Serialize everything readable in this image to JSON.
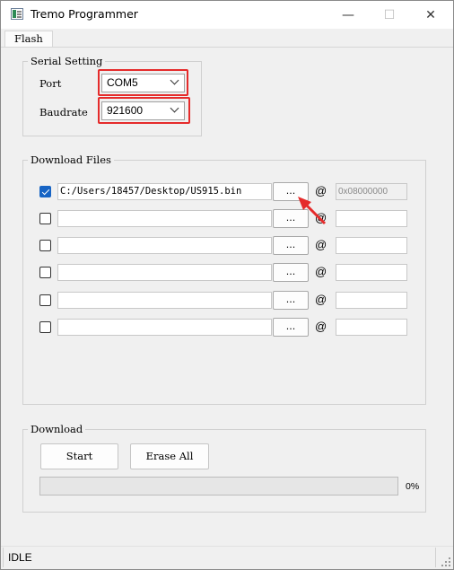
{
  "window": {
    "title": "Tremo Programmer",
    "controls": {
      "minimize": "—",
      "maximize": "☐",
      "close": "✕"
    }
  },
  "menu": {
    "flash": "Flash"
  },
  "serial": {
    "group_title": "Serial Setting",
    "port_label": "Port",
    "port_value": "COM5",
    "baudrate_label": "Baudrate",
    "baudrate_value": "921600"
  },
  "download_files": {
    "group_title": "Download Files",
    "at_symbol": "@",
    "browse_label": "...",
    "rows": [
      {
        "checked": true,
        "path": "C:/Users/18457/Desktop/US915.bin",
        "address": "0x08000000"
      },
      {
        "checked": false,
        "path": "",
        "address": ""
      },
      {
        "checked": false,
        "path": "",
        "address": ""
      },
      {
        "checked": false,
        "path": "",
        "address": ""
      },
      {
        "checked": false,
        "path": "",
        "address": ""
      },
      {
        "checked": false,
        "path": "",
        "address": ""
      }
    ]
  },
  "download": {
    "group_title": "Download",
    "start_label": "Start",
    "erase_label": "Erase All",
    "progress_percent": 0,
    "progress_text": "0%"
  },
  "status": {
    "text": "IDLE"
  },
  "annotation_color": "#e52b2b",
  "accent_color": "#1764c4"
}
